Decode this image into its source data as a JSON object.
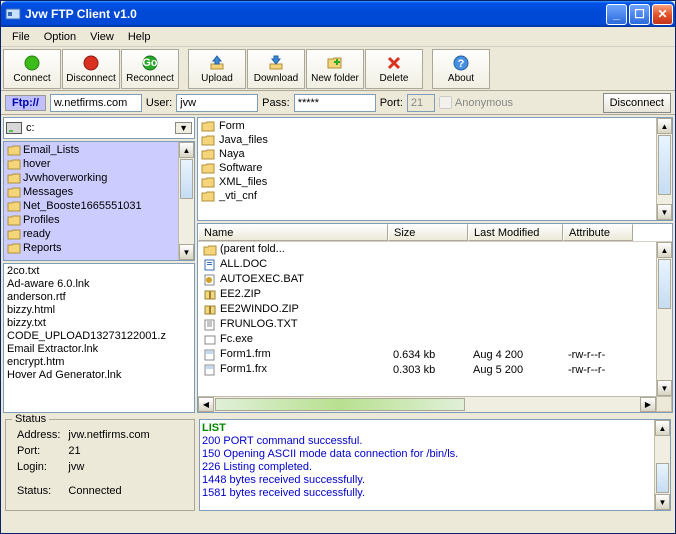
{
  "window": {
    "title": "Jvw FTP Client v1.0"
  },
  "menu": {
    "file": "File",
    "option": "Option",
    "view": "View",
    "help": "Help"
  },
  "toolbar": {
    "connect": "Connect",
    "disconnect": "Disconnect",
    "reconnect": "Reconnect",
    "upload": "Upload",
    "download": "Download",
    "newfolder": "New folder",
    "delete": "Delete",
    "about": "About"
  },
  "conn": {
    "ftp_label": "Ftp://",
    "host": "w.netfirms.com",
    "user_label": "User:",
    "user": "jvw",
    "pass_label": "Pass:",
    "pass": "*****",
    "port_label": "Port:",
    "port": "21",
    "anon": "Anonymous",
    "disconnect_btn": "Disconnect"
  },
  "drive": {
    "label": "c:"
  },
  "local_folders": [
    "Email_Lists",
    "hover",
    "Jvwhoverworking",
    "Messages",
    "Net_Booste1665551031",
    "Profiles",
    "ready",
    "Reports"
  ],
  "local_files": [
    "2co.txt",
    "Ad-aware 6.0.lnk",
    "anderson.rtf",
    "bizzy.html",
    "bizzy.txt",
    "CODE_UPLOAD13273122001.z",
    "Email Extractor.lnk",
    "encrypt.htm",
    "Hover Ad Generator.lnk"
  ],
  "remote_folders": [
    "Form",
    "Java_files",
    "Naya",
    "Software",
    "XML_files",
    "_vti_cnf"
  ],
  "grid": {
    "headers": {
      "name": "Name",
      "size": "Size",
      "mod": "Last Modified",
      "attr": "Attribute"
    },
    "rows": [
      {
        "icon": "folder",
        "name": "(parent fold...",
        "size": "",
        "mod": "",
        "attr": ""
      },
      {
        "icon": "doc",
        "name": "ALL.DOC",
        "size": "",
        "mod": "",
        "attr": ""
      },
      {
        "icon": "bat",
        "name": "AUTOEXEC.BAT",
        "size": "",
        "mod": "",
        "attr": ""
      },
      {
        "icon": "zip",
        "name": "EE2.ZIP",
        "size": "",
        "mod": "",
        "attr": ""
      },
      {
        "icon": "zip",
        "name": "EE2WINDO.ZIP",
        "size": "",
        "mod": "",
        "attr": ""
      },
      {
        "icon": "txt",
        "name": "FRUNLOG.TXT",
        "size": "",
        "mod": "",
        "attr": ""
      },
      {
        "icon": "exe",
        "name": "Fc.exe",
        "size": "",
        "mod": "",
        "attr": ""
      },
      {
        "icon": "frm",
        "name": "Form1.frm",
        "size": "0.634 kb",
        "mod": "Aug  4  200",
        "attr": "-rw-r--r-"
      },
      {
        "icon": "frm",
        "name": "Form1.frx",
        "size": "0.303 kb",
        "mod": "Aug  5  200",
        "attr": "-rw-r--r-"
      }
    ]
  },
  "status": {
    "legend": "Status",
    "addr_l": "Address:",
    "addr": "jvw.netfirms.com",
    "port_l": "Port:",
    "port": "21",
    "login_l": "Login:",
    "login": "jvw",
    "status_l": "Status:",
    "status": "Connected"
  },
  "log": [
    {
      "cls": "green",
      "text": "LIST"
    },
    {
      "cls": "",
      "text": "200 PORT command successful."
    },
    {
      "cls": "",
      "text": "150 Opening ASCII mode data connection for /bin/ls."
    },
    {
      "cls": "",
      "text": "226 Listing completed."
    },
    {
      "cls": "",
      "text": "1448 bytes received successfully."
    },
    {
      "cls": "",
      "text": "1581 bytes received successfully."
    }
  ]
}
